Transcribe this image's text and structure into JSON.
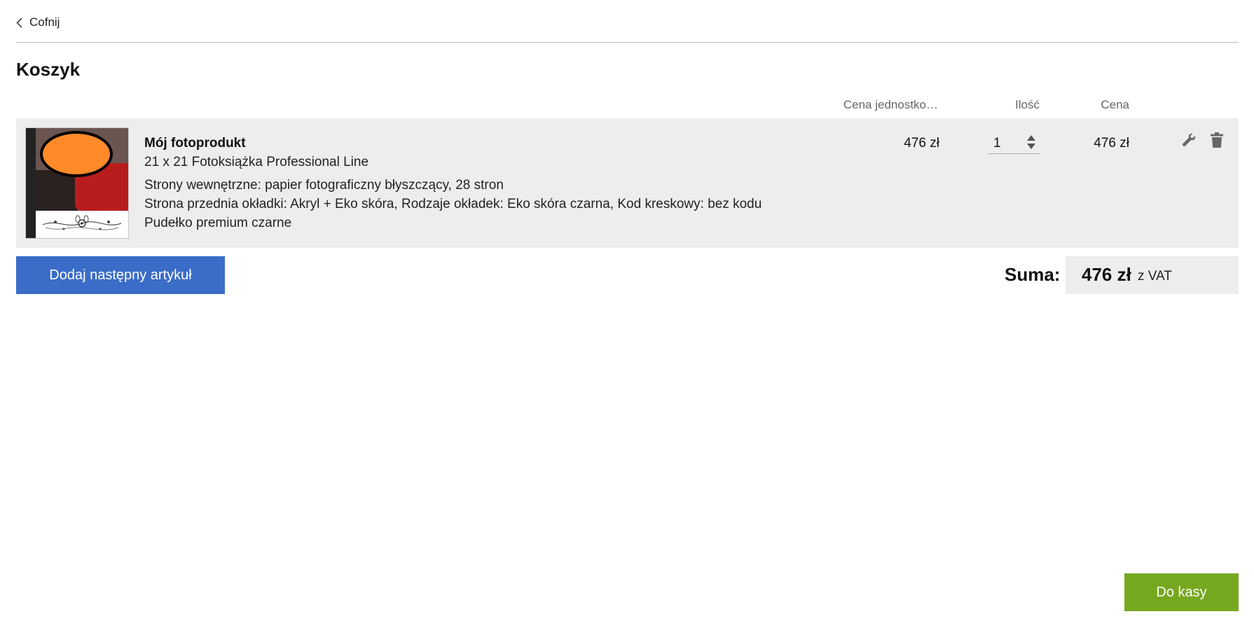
{
  "nav": {
    "back_label": "Cofnij"
  },
  "page": {
    "title": "Koszyk"
  },
  "columns": {
    "unit_price": "Cena jednostko…",
    "quantity": "Ilość",
    "price": "Cena"
  },
  "cart": {
    "items": [
      {
        "name": "Mój fotoprodukt",
        "subtitle": "21 x 21 Fotoksiążka Professional Line",
        "details": [
          "Strony wewnętrzne: papier fotograficzny błyszczący, 28 stron",
          "Strona przednia okładki: Akryl + Eko skóra, Rodzaje okładek: Eko skóra czarna, Kod kreskowy: bez kodu",
          "Pudełko premium czarne"
        ],
        "unit_price": "476 zł",
        "quantity": "1",
        "price": "476 zł",
        "icons": {
          "edit": "wrench-icon",
          "delete": "trash-icon"
        }
      }
    ]
  },
  "actions": {
    "add_item_label": "Dodaj następny artykuł",
    "checkout_label": "Do kasy"
  },
  "summary": {
    "label": "Suma:",
    "value": "476 zł",
    "vat_note": "z VAT"
  },
  "colors": {
    "primary_button": "#3a6cc8",
    "checkout_button": "#76a81f",
    "row_background": "#ededed"
  }
}
